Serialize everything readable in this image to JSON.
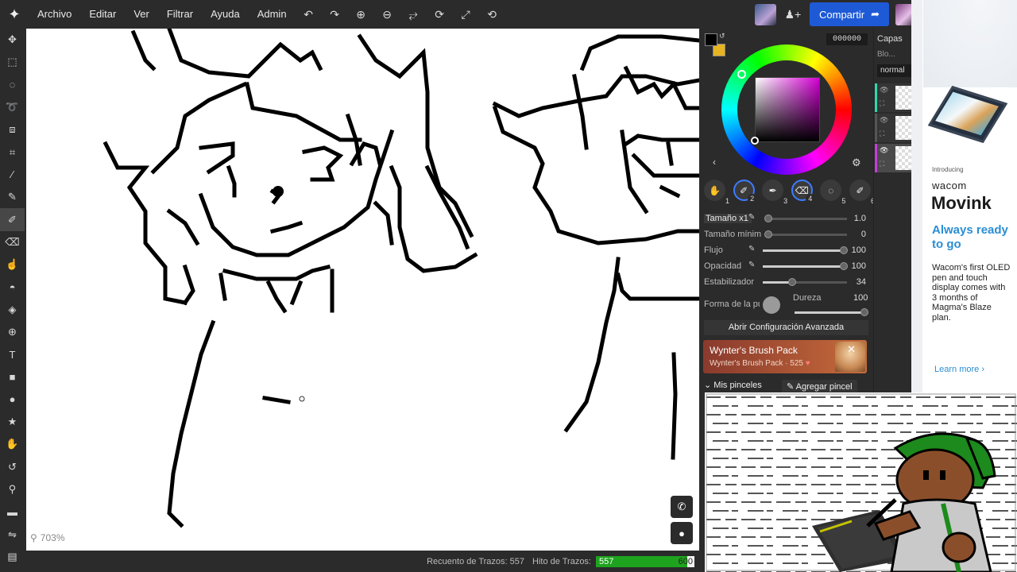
{
  "menu": [
    "Archivo",
    "Editar",
    "Ver",
    "Filtrar",
    "Ayuda",
    "Admin"
  ],
  "toolbar_icons": [
    "undo-icon",
    "redo-icon",
    "zoom-in-icon",
    "zoom-out-icon",
    "fit-icon",
    "rotate-icon",
    "fullscreen-icon",
    "reset-rotation-icon"
  ],
  "share_label": "Compartir",
  "left_tools": [
    "move-icon",
    "rect-select-icon",
    "ellipse-select-icon",
    "lasso-icon",
    "transform-icon",
    "crop-icon",
    "eyedropper-icon",
    "pencil-icon",
    "brush-icon",
    "eraser-icon",
    "smudge-icon",
    "blur-icon",
    "fill-icon",
    "stamp-icon",
    "text-icon",
    "rectangle-icon",
    "ellipse-icon",
    "star-icon",
    "hand-icon",
    "history-icon",
    "search-icon",
    "chat-icon",
    "flip-icon",
    "film-icon"
  ],
  "active_tool_index": 8,
  "zoom_label": "703%",
  "status": {
    "stroke_count_label": "Recuento de Trazos: 557",
    "hit_label": "Hito de Trazos:",
    "hit_current": "557",
    "hit_max": "600",
    "hit_progress": 0.928
  },
  "color": {
    "hex": "000000",
    "primary": "#000000",
    "secondary": "#e6b422"
  },
  "brushes": [
    {
      "num": "1",
      "icon": "hand-icon"
    },
    {
      "num": "2",
      "icon": "brush-icon",
      "selected": true
    },
    {
      "num": "3",
      "icon": "pen-icon"
    },
    {
      "num": "4",
      "icon": "eraser-icon",
      "selected": true
    },
    {
      "num": "5",
      "icon": "dotted-circle-icon"
    },
    {
      "num": "6",
      "icon": "brush-icon"
    }
  ],
  "settings": {
    "size_label": "Tamaño x1",
    "size_value": "1.0",
    "min_size_label": "Tamaño mínimo",
    "min_size_value": "0",
    "flow_label": "Flujo",
    "flow_value": "100",
    "opacity_label": "Opacidad",
    "opacity_value": "100",
    "stabilizer_label": "Estabilizador",
    "stabilizer_value": "34",
    "tip_label": "Forma de la punta",
    "hardness_label": "Dureza",
    "hardness_value": "100"
  },
  "advanced_button": "Abrir Configuración Avanzada",
  "promo": {
    "title": "Wynter's Brush Pack",
    "subtitle": "Wynter's Brush Pack · 525 ",
    "close": "✕"
  },
  "my_brushes_label": "Mis pinceles",
  "add_brush_label": "Agregar pincel",
  "layers": {
    "title": "Capas",
    "lock_label": "Blo...",
    "blend_mode": "normal"
  },
  "ad": {
    "intro": "Introducing",
    "brand": "wacom",
    "product": "Movink",
    "headline": "Always ready to go",
    "body": "Wacom's first OLED pen and touch display comes with 3 months of Magma's Blaze plan.",
    "cta": "Learn more"
  }
}
